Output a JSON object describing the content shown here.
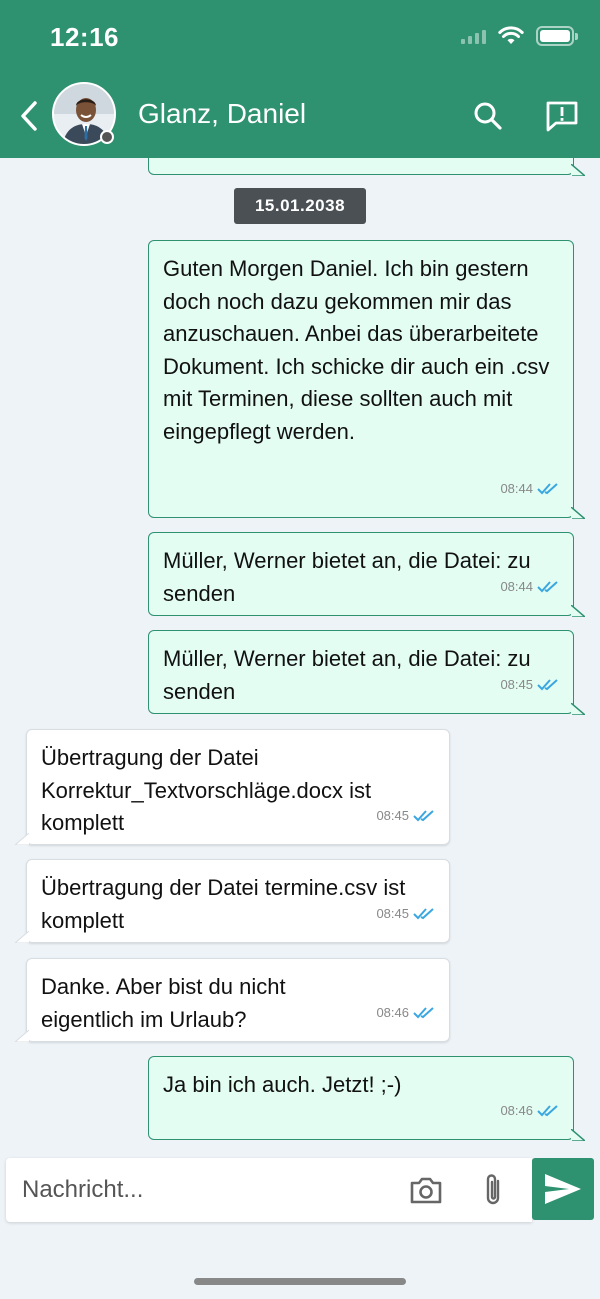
{
  "status_bar": {
    "time": "12:16"
  },
  "header": {
    "contact_name": "Glanz, Daniel"
  },
  "date_separator": "15.01.2038",
  "messages": [
    {
      "direction": "out",
      "text": "Guten Morgen Daniel. Ich bin gestern doch noch dazu gekommen mir das anzuschauen. Anbei das überarbeitete Dokument. Ich schicke dir auch ein .csv mit Terminen, diese sollten auch mit eingepflegt werden.",
      "time": "08:44"
    },
    {
      "direction": "out",
      "text": "Müller, Werner bietet an, die Datei: zu senden",
      "time": "08:44"
    },
    {
      "direction": "out",
      "text": "Müller, Werner bietet an, die Datei: zu senden",
      "time": "08:45"
    },
    {
      "direction": "in",
      "text": "Übertragung der Datei Korrektur_Textvorschläge.docx ist komplett",
      "time": "08:45"
    },
    {
      "direction": "in",
      "text": "Übertragung der Datei termine.csv ist komplett",
      "time": "08:45"
    },
    {
      "direction": "in",
      "text": "Danke. Aber bist du nicht eigentlich im Urlaub?",
      "time": "08:46"
    },
    {
      "direction": "out",
      "text": "Ja bin ich auch. Jetzt! ;-)",
      "time": "08:46"
    }
  ],
  "composer": {
    "placeholder": "Nachricht..."
  },
  "colors": {
    "accent": "#2e9170",
    "outgoing_bg": "#e3fdf3",
    "incoming_bg": "#ffffff",
    "read_check": "#3aa7e0"
  },
  "icons": [
    "back-chevron-icon",
    "search-icon",
    "report-icon",
    "camera-icon",
    "paperclip-icon",
    "send-icon",
    "double-check-icon"
  ]
}
